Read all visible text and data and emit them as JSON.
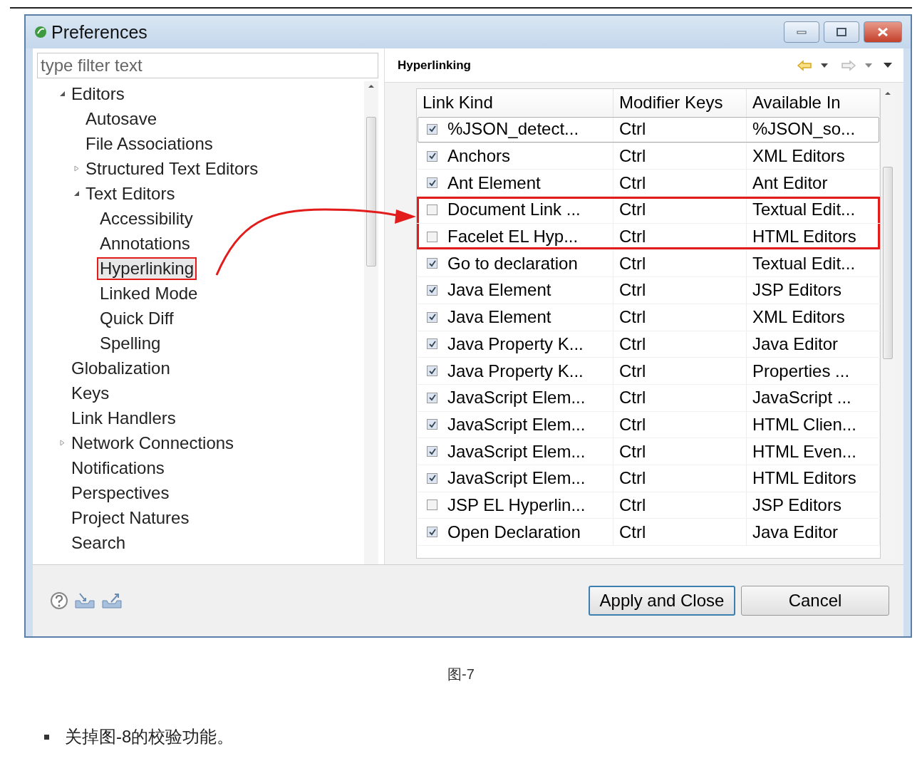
{
  "window": {
    "title": "Preferences"
  },
  "filter": {
    "placeholder": "type filter text"
  },
  "tree": [
    {
      "label": "Editors",
      "expanded": true,
      "selected": false,
      "children": [
        {
          "label": "Autosave",
          "selected": false
        },
        {
          "label": "File Associations",
          "selected": false
        },
        {
          "label": "Structured Text Editors",
          "expanded": false,
          "selected": false
        },
        {
          "label": "Text Editors",
          "expanded": true,
          "selected": false,
          "children": [
            {
              "label": "Accessibility",
              "selected": false
            },
            {
              "label": "Annotations",
              "selected": false
            },
            {
              "label": "Hyperlinking",
              "selected": true,
              "highlighted": true
            },
            {
              "label": "Linked Mode",
              "selected": false
            },
            {
              "label": "Quick Diff",
              "selected": false
            },
            {
              "label": "Spelling",
              "selected": false
            }
          ]
        }
      ]
    },
    {
      "label": "Globalization",
      "selected": false
    },
    {
      "label": "Keys",
      "selected": false
    },
    {
      "label": "Link Handlers",
      "selected": false
    },
    {
      "label": "Network Connections",
      "expanded": false,
      "selected": false
    },
    {
      "label": "Notifications",
      "selected": false
    },
    {
      "label": "Perspectives",
      "selected": false
    },
    {
      "label": "Project Natures",
      "selected": false
    },
    {
      "label": "Search",
      "selected": false
    }
  ],
  "page": {
    "title": "Hyperlinking"
  },
  "table": {
    "columns": [
      "Link Kind",
      "Modifier Keys",
      "Available In"
    ],
    "rows": [
      {
        "checked": true,
        "selected": true,
        "highlighted": false,
        "cells": [
          "%JSON_detect...",
          "Ctrl",
          "%JSON_so..."
        ]
      },
      {
        "checked": true,
        "selected": false,
        "highlighted": false,
        "cells": [
          "Anchors",
          "Ctrl",
          "XML Editors"
        ]
      },
      {
        "checked": true,
        "selected": false,
        "highlighted": false,
        "cells": [
          "Ant Element",
          "Ctrl",
          "Ant Editor"
        ]
      },
      {
        "checked": false,
        "selected": false,
        "highlighted": true,
        "cells": [
          "Document Link ...",
          "Ctrl",
          "Textual Edit..."
        ]
      },
      {
        "checked": false,
        "selected": false,
        "highlighted": true,
        "cells": [
          "Facelet EL Hyp...",
          "Ctrl",
          "HTML Editors"
        ]
      },
      {
        "checked": true,
        "selected": false,
        "highlighted": false,
        "cells": [
          "Go to declaration",
          "Ctrl",
          "Textual Edit..."
        ]
      },
      {
        "checked": true,
        "selected": false,
        "highlighted": false,
        "cells": [
          "Java Element",
          "Ctrl",
          "JSP Editors"
        ]
      },
      {
        "checked": true,
        "selected": false,
        "highlighted": false,
        "cells": [
          "Java Element",
          "Ctrl",
          "XML Editors"
        ]
      },
      {
        "checked": true,
        "selected": false,
        "highlighted": false,
        "cells": [
          "Java Property K...",
          "Ctrl",
          "Java Editor"
        ]
      },
      {
        "checked": true,
        "selected": false,
        "highlighted": false,
        "cells": [
          "Java Property K...",
          "Ctrl",
          "Properties ..."
        ]
      },
      {
        "checked": true,
        "selected": false,
        "highlighted": false,
        "cells": [
          "JavaScript Elem...",
          "Ctrl",
          "JavaScript ..."
        ]
      },
      {
        "checked": true,
        "selected": false,
        "highlighted": false,
        "cells": [
          "JavaScript Elem...",
          "Ctrl",
          "HTML Clien..."
        ]
      },
      {
        "checked": true,
        "selected": false,
        "highlighted": false,
        "cells": [
          "JavaScript Elem...",
          "Ctrl",
          "HTML Even..."
        ]
      },
      {
        "checked": true,
        "selected": false,
        "highlighted": false,
        "cells": [
          "JavaScript Elem...",
          "Ctrl",
          "HTML Editors"
        ]
      },
      {
        "checked": false,
        "selected": false,
        "highlighted": false,
        "cells": [
          "JSP EL Hyperlin...",
          "Ctrl",
          "JSP Editors"
        ]
      },
      {
        "checked": true,
        "selected": false,
        "highlighted": false,
        "cells": [
          "Open Declaration",
          "Ctrl",
          "Java Editor"
        ]
      }
    ]
  },
  "buttons": [
    {
      "label": "Apply and Close",
      "default": true
    },
    {
      "label": "Cancel",
      "default": false
    }
  ],
  "caption": "图-7",
  "bullet": "关掉图-8的校验功能。"
}
